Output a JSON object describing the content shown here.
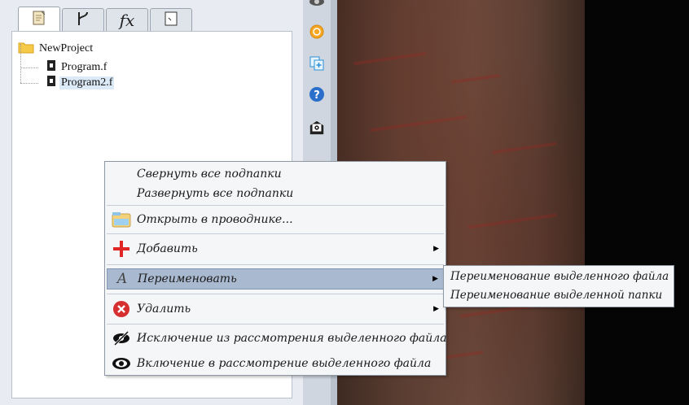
{
  "tabs": [
    {
      "icon": "document-icon"
    },
    {
      "icon": "branch-icon"
    },
    {
      "icon": "function-icon",
      "label": "fx"
    },
    {
      "icon": "page-icon"
    }
  ],
  "tree": {
    "root": {
      "label": "NewProject",
      "icon": "folder-icon"
    },
    "files": [
      {
        "label": "Program.f",
        "icon": "file-icon"
      },
      {
        "label": "Program2.f",
        "icon": "file-icon",
        "selected": true
      }
    ]
  },
  "toolbar_icons": [
    "eye-icon",
    "orange-circle-icon",
    "copy-plus-icon",
    "help-icon",
    "mail-settings-icon"
  ],
  "context_menu": {
    "items": [
      {
        "label": "Свернуть все подпапки"
      },
      {
        "label": "Развернуть все подпапки"
      },
      {
        "label": "Открыть в проводнике...",
        "icon": "open-explorer-icon"
      },
      {
        "label": "Добавить",
        "icon": "add-icon",
        "submenu": true
      },
      {
        "label": "Переименовать",
        "icon": "rename-icon",
        "submenu": true,
        "highlighted": true
      },
      {
        "label": "Удалить",
        "icon": "delete-icon",
        "submenu": true
      },
      {
        "label": "Исключение из рассмотрения выделенного файла",
        "icon": "eye-crossed-icon"
      },
      {
        "label": "Включение в рассмотрение выделенного файла",
        "icon": "eye-icon"
      }
    ]
  },
  "rename_submenu": {
    "items": [
      {
        "label": "Переименование выделенного файла"
      },
      {
        "label": "Переименование выделенной папки"
      }
    ]
  },
  "colors": {
    "highlight": "#a9b9cf",
    "menu_bg": "#f5f6f8",
    "panel_bg": "#e8ebf1"
  }
}
